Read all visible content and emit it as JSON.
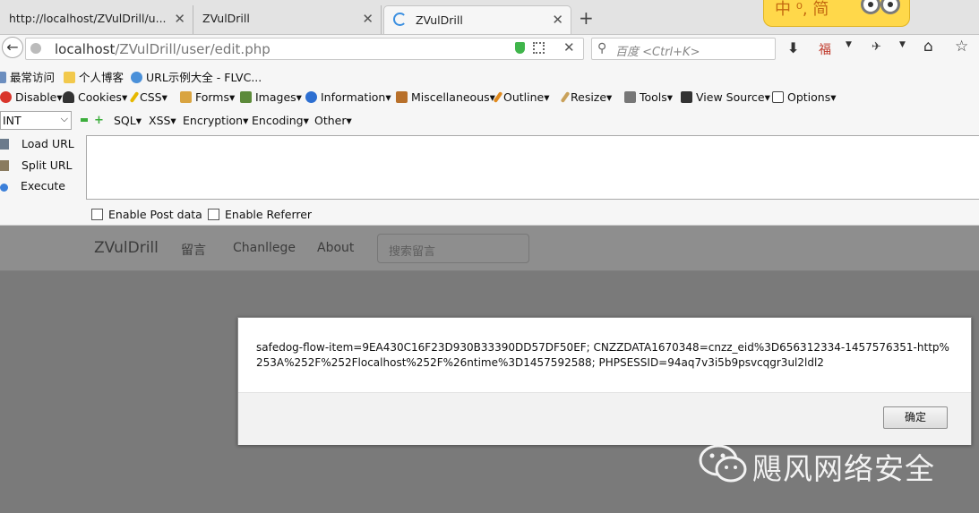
{
  "tabs": [
    {
      "label": "http://localhost/ZVulDrill/u..."
    },
    {
      "label": "ZVulDrill"
    },
    {
      "label": "ZVulDrill"
    }
  ],
  "navbar": {
    "url_host": "localhost",
    "url_path": "/ZVulDrill/user/edit.php",
    "search_placeholder": "百度 <Ctrl+K>"
  },
  "bookmarks": [
    {
      "label": "最常访问"
    },
    {
      "label": "个人博客"
    },
    {
      "label": "URL示例大全 - FLVC..."
    }
  ],
  "webdev_toolbar": [
    {
      "label": "Disable▾"
    },
    {
      "label": "Cookies▾"
    },
    {
      "label": "CSS▾"
    },
    {
      "label": "Forms▾"
    },
    {
      "label": "Images▾"
    },
    {
      "label": "Information▾"
    },
    {
      "label": "Miscellaneous▾"
    },
    {
      "label": "Outline▾"
    },
    {
      "label": "Resize▾"
    },
    {
      "label": "Tools▾"
    },
    {
      "label": "View Source▾"
    },
    {
      "label": "Options▾"
    }
  ],
  "hackbar": {
    "select_value": "INT",
    "menus": [
      "SQL▾",
      "XSS▾",
      "Encryption▾",
      "Encoding▾",
      "Other▾"
    ],
    "load_url": "Load URL",
    "split_url": "Split URL",
    "execute": "Execute",
    "enable_post": "Enable Post data",
    "enable_referrer": "Enable Referrer"
  },
  "site_nav": {
    "brand": "ZVulDrill",
    "links": [
      "留言",
      "Chanllege",
      "About"
    ],
    "search_placeholder": "搜索留言"
  },
  "alert": {
    "message": "safedog-flow-item=9EA430C16F23D930B33390DD57DF50EF; CNZZDATA1670348=cnzz_eid%3D656312334-1457576351-http%253A%252F%252Flocalhost%252F%26ntime%3D1457592588; PHPSESSID=94aq7v3i5b9psvcqgr3ul2ldl2",
    "ok_label": "确定"
  },
  "ime_widget": {
    "text": "中 ⁰, 简"
  },
  "watermark": {
    "text": "飓风网络安全"
  }
}
